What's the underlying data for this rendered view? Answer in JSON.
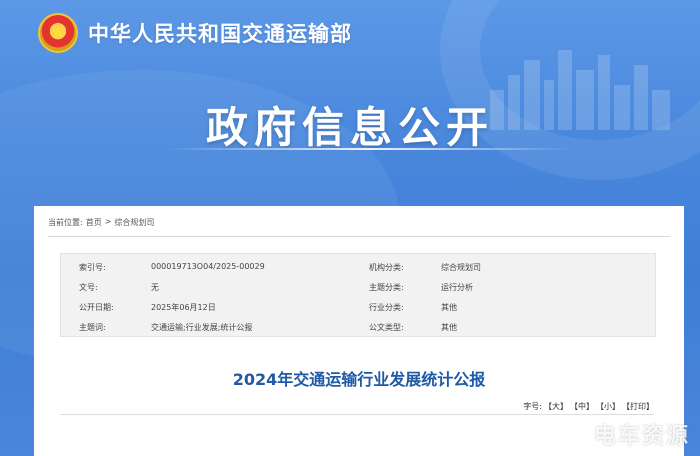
{
  "header": {
    "ministry_name": "中华人民共和国交通运输部",
    "page_title": "政府信息公开"
  },
  "breadcrumb": {
    "prefix": "当前位置:",
    "home": "首页",
    "separator": ">",
    "current": "综合规划司"
  },
  "metadata": {
    "rows": [
      {
        "label1": "索引号:",
        "value1": "000019713O04/2025-00029",
        "label2": "机构分类:",
        "value2": "综合规划司"
      },
      {
        "label1": "文号:",
        "value1": "无",
        "label2": "主题分类:",
        "value2": "运行分析"
      },
      {
        "label1": "公开日期:",
        "value1": "2025年06月12日",
        "label2": "行业分类:",
        "value2": "其他"
      },
      {
        "label1": "主题词:",
        "value1": "交通运输;行业发展;统计公报",
        "label2": "公文类型:",
        "value2": "其他"
      }
    ]
  },
  "document": {
    "title": "2024年交通运输行业发展统计公报"
  },
  "font_size": {
    "label": "字号:",
    "large": "【大】",
    "medium": "【中】",
    "small": "【小】",
    "print": "【打印】"
  },
  "watermark": "电车资源",
  "colors": {
    "header_blue": "#4a88dd",
    "title_blue": "#1f5aa8"
  }
}
